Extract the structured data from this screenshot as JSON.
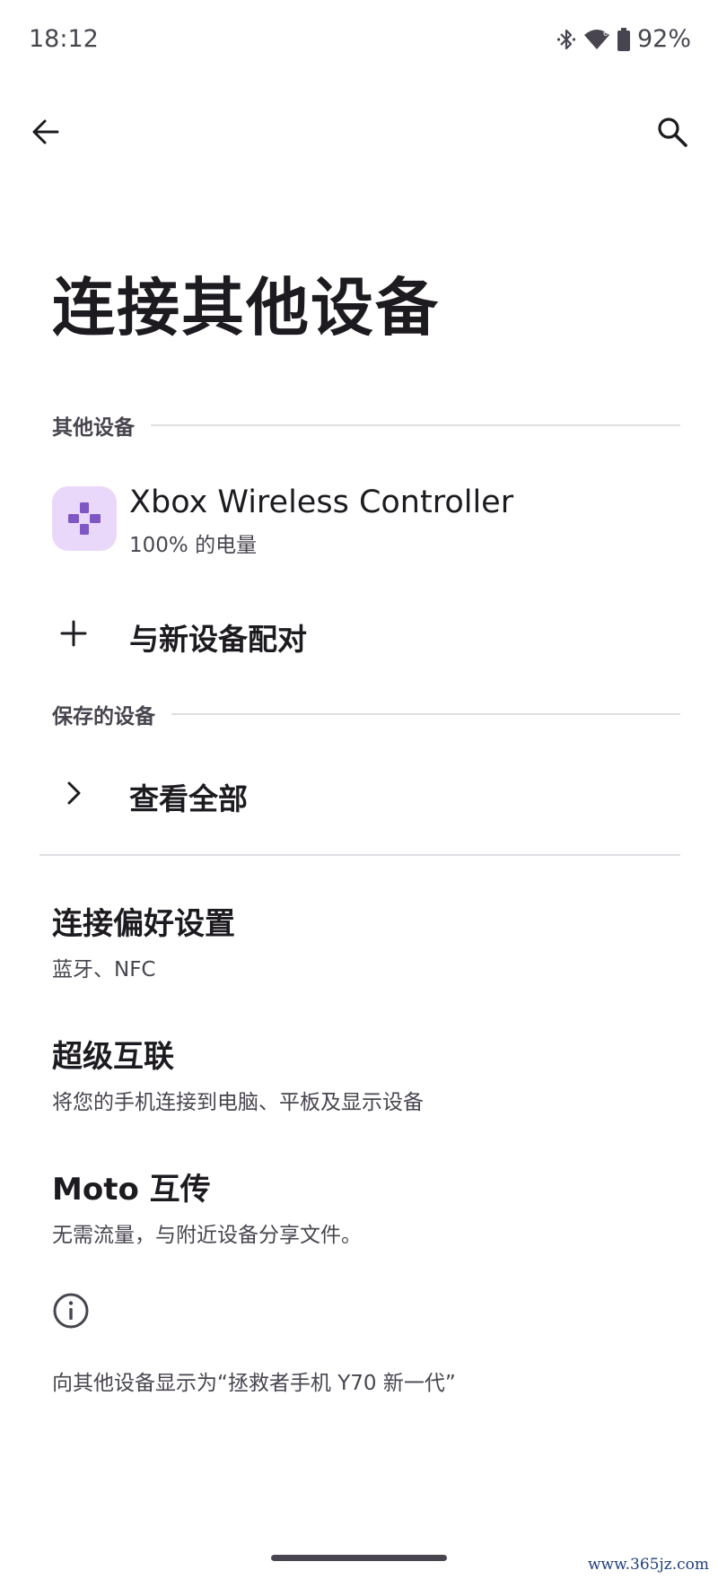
{
  "status_bar": {
    "time": "18:12",
    "battery_percent": "92%",
    "icons": [
      "bluetooth-icon",
      "wifi-icon",
      "battery-icon"
    ]
  },
  "toolbar": {
    "back_icon": "arrow-back-icon",
    "search_icon": "search-icon"
  },
  "page": {
    "title": "连接其他设备"
  },
  "other_devices": {
    "header": "其他设备",
    "device": {
      "name": "Xbox Wireless Controller",
      "status": "100% 的电量",
      "icon": "gamepad-icon",
      "icon_bg": "#ead8fb",
      "icon_color": "#7e57c2"
    },
    "pair_label": "与新设备配对"
  },
  "saved_devices": {
    "header": "保存的设备",
    "see_all_label": "查看全部"
  },
  "preferences": [
    {
      "title": "连接偏好设置",
      "subtitle": "蓝牙、NFC"
    },
    {
      "title": "超级互联",
      "subtitle": "将您的手机连接到电脑、平板及显示设备"
    },
    {
      "title": "Moto 互传",
      "subtitle": "无需流量，与附近设备分享文件。"
    }
  ],
  "footer": {
    "info_icon": "info-icon",
    "visible_as": "向其他设备显示为“拯救者手机 Y70 新一代”"
  },
  "watermark": "www.365jz.com"
}
